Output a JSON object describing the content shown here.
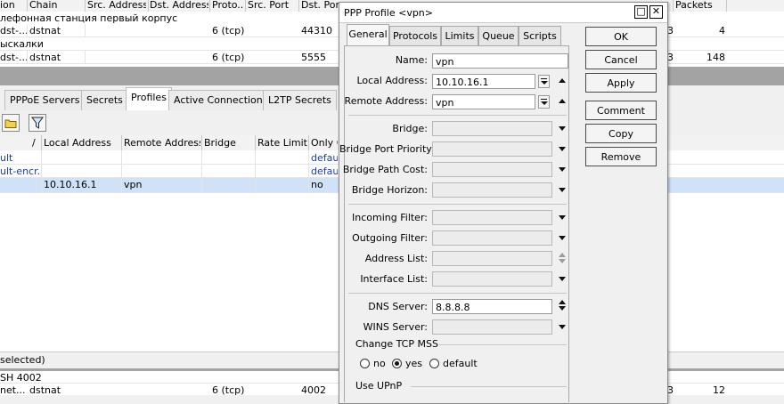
{
  "top_table": {
    "headers": [
      "ion",
      "Chain",
      "Src. Address",
      "Dst. Address",
      "Proto...",
      "Src. Port",
      "Dst. Port",
      "Packets"
    ],
    "comment1": "лефонная станция первый корпус",
    "row1": {
      "action": "dst-...",
      "chain": "dstnat",
      "proto": "6 (tcp)",
      "dst_port": "44310",
      "right_a": "3",
      "packets": "4"
    },
    "comment2": "ыскалки",
    "row2": {
      "action": "dst-...",
      "chain": "dstnat",
      "proto": "6 (tcp)",
      "dst_port": "5555",
      "right_a": "3",
      "packets": "148"
    }
  },
  "ppp_tabs": [
    "PPPoE Servers",
    "Secrets",
    "Profiles",
    "Active Connections",
    "L2TP Secrets"
  ],
  "ppp_table": {
    "headers": [
      "/",
      "Local Address",
      "Remote Address",
      "Bridge",
      "Rate Limit...",
      "Only O"
    ],
    "rows": [
      {
        "name": "ult",
        "local": "",
        "remote": "",
        "only": "default"
      },
      {
        "name": "ult-encr...",
        "local": "",
        "remote": "",
        "only": "default"
      },
      {
        "name": "",
        "local": "10.10.16.1",
        "remote": "vpn",
        "only": "no"
      }
    ]
  },
  "status_bar": "selected)",
  "bottom_table": {
    "comment": "SH 4002",
    "row": {
      "action": "net...",
      "chain": "dstnat",
      "proto": "6 (tcp)",
      "dst_port": "4002",
      "right_a": "3",
      "packets": "12"
    }
  },
  "dialog": {
    "title": "PPP Profile <vpn>",
    "min_icon": "□",
    "close_icon": "✕",
    "tabs": [
      "General",
      "Protocols",
      "Limits",
      "Queue",
      "Scripts"
    ],
    "fields": {
      "name_label": "Name:",
      "name_value": "vpn",
      "local_label": "Local Address:",
      "local_value": "10.10.16.1",
      "remote_label": "Remote Address:",
      "remote_value": "vpn",
      "bridge_label": "Bridge:",
      "bridge_port_priority_label": "Bridge Port Priority:",
      "bridge_path_cost_label": "Bridge Path Cost:",
      "bridge_horizon_label": "Bridge Horizon:",
      "incoming_filter_label": "Incoming Filter:",
      "outgoing_filter_label": "Outgoing Filter:",
      "address_list_label": "Address List:",
      "interface_list_label": "Interface List:",
      "dns_label": "DNS Server:",
      "dns_value": "8.8.8.8",
      "wins_label": "WINS Server:",
      "change_tcp_mss_label": "Change TCP MSS",
      "mss_options": [
        "no",
        "yes",
        "default"
      ],
      "mss_selected": "yes",
      "use_upnp_label": "Use UPnP"
    },
    "buttons": [
      "OK",
      "Cancel",
      "Apply",
      "Comment",
      "Copy",
      "Remove"
    ]
  }
}
